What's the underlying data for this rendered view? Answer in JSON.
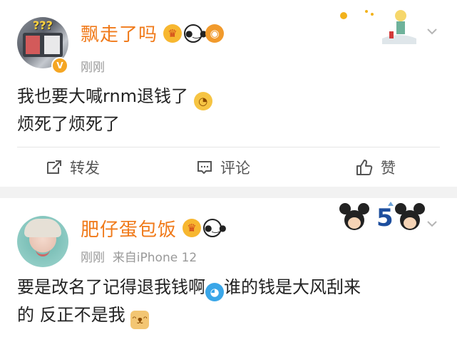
{
  "posts": [
    {
      "username": "飘走了吗",
      "badges": [
        "crown-emoji",
        "panda-emoji",
        "fish-emoji"
      ],
      "verified_badge": "V",
      "time": "刚刚",
      "content_line1": "我也要大喊rnm退钱了",
      "content_line2": "烦死了烦死了",
      "actions": {
        "share": "转发",
        "comment": "评论",
        "like": "赞"
      }
    },
    {
      "username": "肥仔蛋包饭",
      "badges": [
        "crown-emoji",
        "panda-emoji"
      ],
      "time": "刚刚",
      "source": "来自iPhone 12",
      "content_line1_a": "要是改名了记得退我钱啊",
      "content_line1_b": "谁的钱是大风刮来",
      "content_line2": "的 反正不是我"
    }
  ],
  "colors": {
    "username": "#f07a1a",
    "meta": "#999999",
    "background": "#f2f2f2"
  }
}
